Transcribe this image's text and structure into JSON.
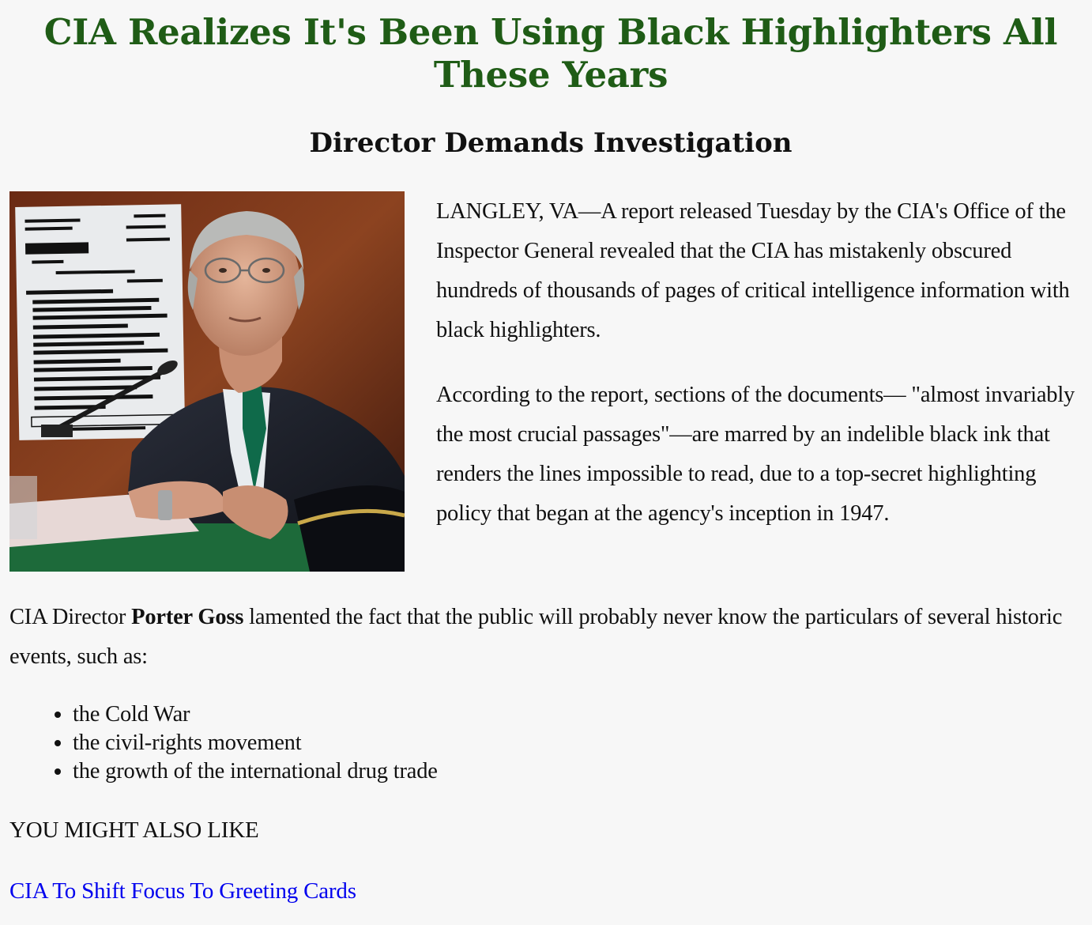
{
  "article": {
    "headline": "CIA Realizes It's Been Using Black Highlighters All These Years",
    "subheadline": "Director Demands Investigation",
    "paragraphs": [
      "LANGLEY, VA—A report released Tuesday by the CIA's Office of the Inspector General revealed that the CIA has mistakenly obscured hundreds of thousands of pages of critical intelligence information with black highlighters.",
      "According to the report, sections of the documents— \"almost invariably the most crucial passages\"—are marred by an indelible black ink that renders the lines impossible to read, due to a top-secret highlighting policy that began at the agency's inception in 1947."
    ],
    "goss_paragraph": {
      "before": "CIA Director ",
      "name": "Porter Goss",
      "after": " lamented the fact that the public will probably never know the particulars of several historic events, such as:"
    },
    "events": [
      "the Cold War",
      "the civil-rights movement",
      "the growth of the international drug trade"
    ]
  },
  "related": {
    "heading": "YOU MIGHT ALSO LIKE",
    "link_text": "CIA To Shift Focus To Greeting Cards"
  },
  "colors": {
    "headline": "#1f5c16",
    "link": "#0000ee",
    "background": "#f7f7f7"
  },
  "photo": {
    "description_icon": "redacted-document-photo"
  }
}
